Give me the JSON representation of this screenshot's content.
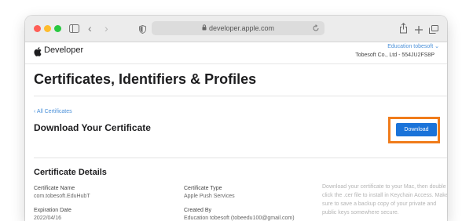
{
  "browser": {
    "url": "developer.apple.com",
    "colors": {
      "close": "#ff5f57",
      "minimize": "#febc2e",
      "maximize": "#28c840"
    }
  },
  "header": {
    "logo_label": "Developer",
    "account_name": "Education tobesoft ⌄",
    "team": "Tobesoft Co., Ltd - 554JU2FS8P"
  },
  "page": {
    "title": "Certificates, Identifiers & Profiles",
    "back_link": "‹ All Certificates",
    "section_title": "Download Your Certificate",
    "download_label": "Download",
    "highlight_color": "#f07c1b"
  },
  "details": {
    "title": "Certificate Details",
    "name_label": "Certificate Name",
    "name_value": "com.tobesoft.EduHubT",
    "type_label": "Certificate Type",
    "type_value": "Apple Push Services",
    "expiration_label": "Expiration Date",
    "expiration_value": "2022/04/16",
    "created_label": "Created By",
    "created_value": "Education tobesoft (tobeedu100@gmail.com)",
    "note": "Download your certificate to your Mac, then double click the .cer file to install in Keychain Access. Make sure to save a backup copy of your private and public keys somewhere secure."
  }
}
